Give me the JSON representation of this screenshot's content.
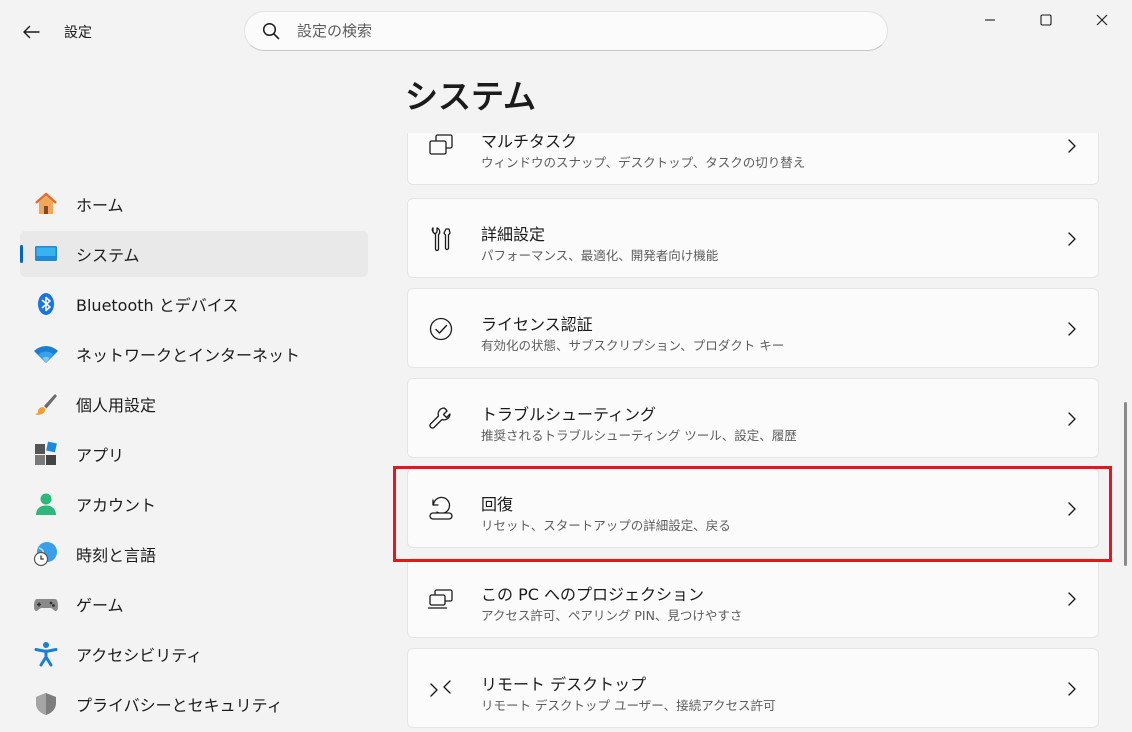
{
  "window": {
    "app_title": "設定",
    "search_placeholder": "設定の検索"
  },
  "sidebar": {
    "items": [
      {
        "label": "ホーム",
        "icon": "home-icon"
      },
      {
        "label": "システム",
        "icon": "system-icon",
        "selected": true
      },
      {
        "label": "Bluetooth とデバイス",
        "icon": "bluetooth-icon"
      },
      {
        "label": "ネットワークとインターネット",
        "icon": "wifi-icon"
      },
      {
        "label": "個人用設定",
        "icon": "brush-icon"
      },
      {
        "label": "アプリ",
        "icon": "apps-icon"
      },
      {
        "label": "アカウント",
        "icon": "account-icon"
      },
      {
        "label": "時刻と言語",
        "icon": "time-language-icon"
      },
      {
        "label": "ゲーム",
        "icon": "gamepad-icon"
      },
      {
        "label": "アクセシビリティ",
        "icon": "accessibility-icon"
      },
      {
        "label": "プライバシーとセキュリティ",
        "icon": "shield-icon"
      }
    ]
  },
  "main": {
    "page_title": "システム",
    "cards": [
      {
        "title": "マルチタスク",
        "desc": "ウィンドウのスナップ、デスクトップ、タスクの切り替え",
        "icon": "multitasking-icon"
      },
      {
        "title": "詳細設定",
        "desc": "パフォーマンス、最適化、開発者向け機能",
        "icon": "tools-icon"
      },
      {
        "title": "ライセンス認証",
        "desc": "有効化の状態、サブスクリプション、プロダクト キー",
        "icon": "check-circle-icon"
      },
      {
        "title": "トラブルシューティング",
        "desc": "推奨されるトラブルシューティング ツール、設定、履歴",
        "icon": "wrench-icon"
      },
      {
        "title": "回復",
        "desc": "リセット、スタートアップの詳細設定、戻る",
        "icon": "recovery-icon"
      },
      {
        "title": "この PC へのプロジェクション",
        "desc": "アクセス許可、ペアリング PIN、見つけやすさ",
        "icon": "projection-icon"
      },
      {
        "title": "リモート デスクトップ",
        "desc": "リモート デスクトップ ユーザー、接続アクセス許可",
        "icon": "remote-desktop-icon"
      }
    ]
  },
  "colors": {
    "accent": "#0067c0",
    "highlight": "#e6161e"
  }
}
